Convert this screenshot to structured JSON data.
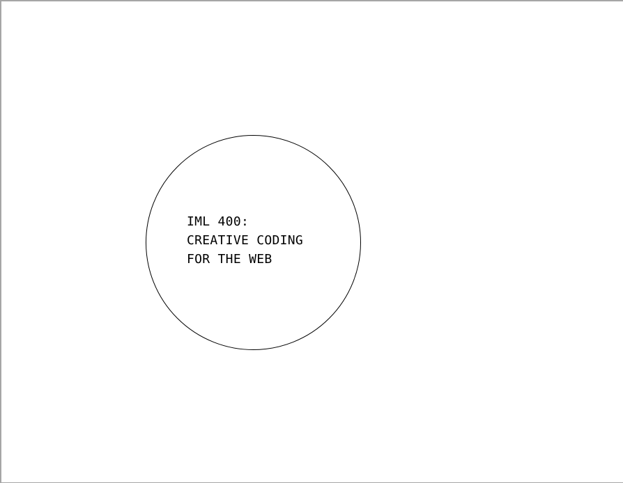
{
  "logo": {
    "lines": [
      "IML 400:",
      "CREATIVE CODING",
      "FOR THE WEB"
    ]
  }
}
